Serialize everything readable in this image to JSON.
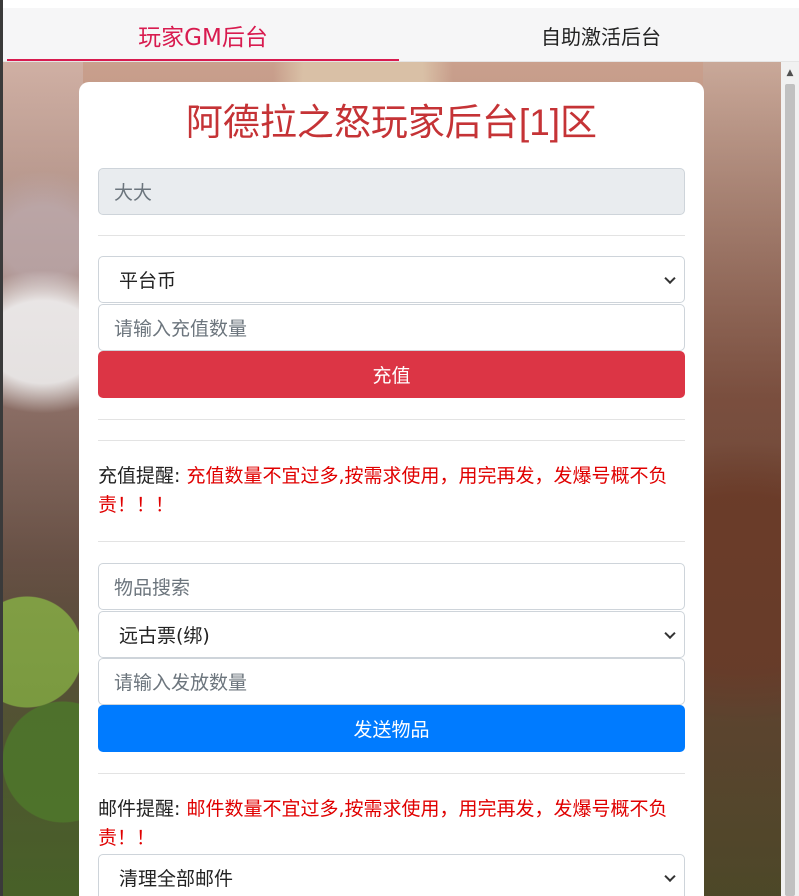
{
  "tabs": [
    {
      "label": "玩家GM后台",
      "active": true
    },
    {
      "label": "自助激活后台",
      "active": false
    }
  ],
  "page_title": "阿德拉之怒玩家后台[1]区",
  "account": {
    "value": "大大"
  },
  "recharge": {
    "currency_selected": "平台币",
    "amount_placeholder": "请输入充值数量",
    "submit_label": "充值",
    "notice_label": "充值提醒:",
    "notice_text": "充值数量不宜过多,按需求使用，用完再发，发爆号概不负责！！！"
  },
  "items": {
    "search_placeholder": "物品搜索",
    "item_selected": "远古票(绑)",
    "quantity_placeholder": "请输入发放数量",
    "submit_label": "发送物品"
  },
  "mail": {
    "notice_label": "邮件提醒:",
    "notice_text": "邮件数量不宜过多,按需求使用，用完再发，发爆号概不负责！！",
    "action_selected": "清理全部邮件"
  },
  "colors": {
    "accent": "#d81b4f",
    "title": "#c53336",
    "danger": "#dc3545",
    "primary": "#007bff",
    "warning_text": "#e00000"
  }
}
